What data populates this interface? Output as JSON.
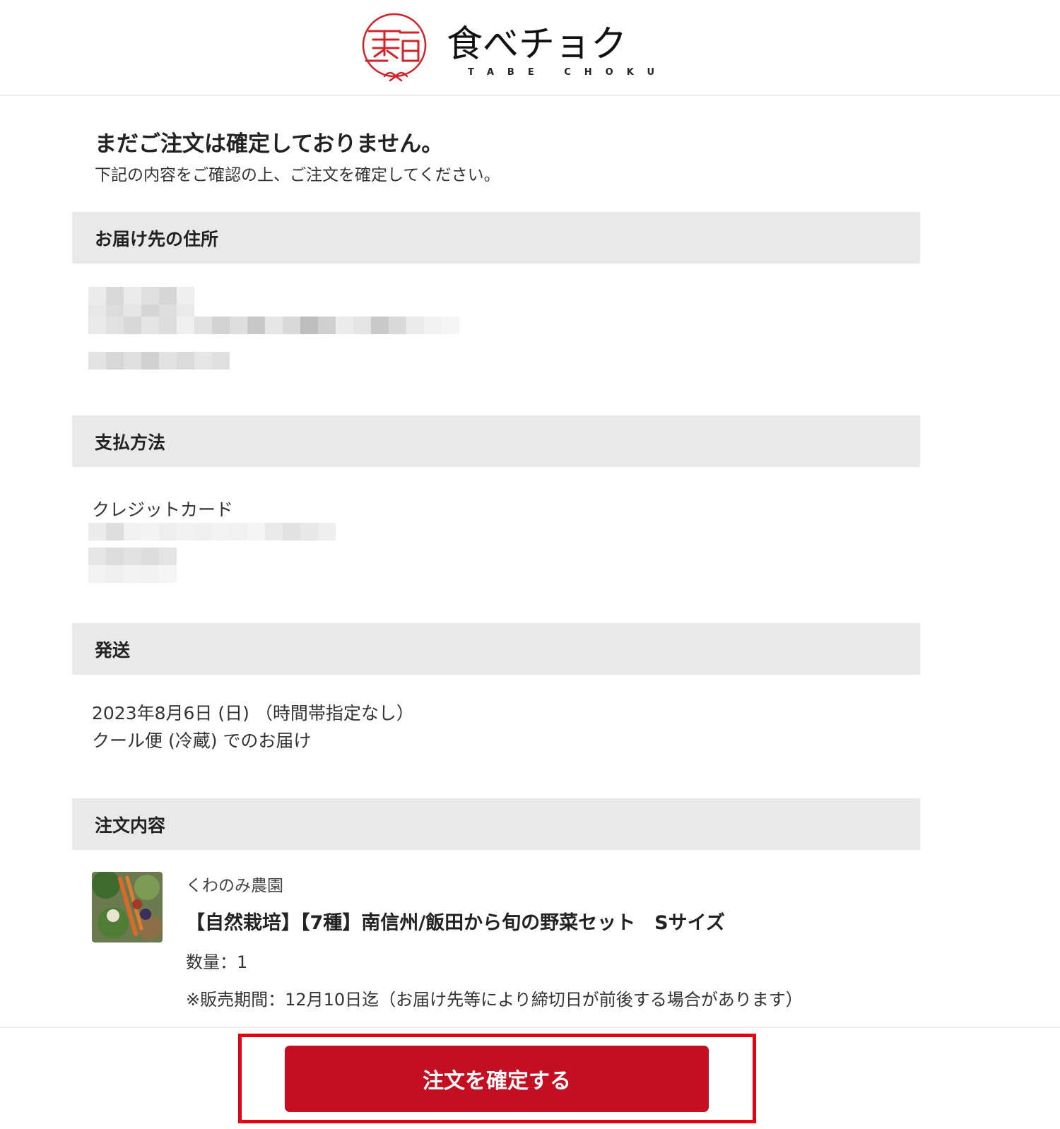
{
  "header": {
    "logo_main": "食べチョク",
    "logo_sub": "TABE CHOKU",
    "logo_mark_icon": "tabechoku-seal-icon",
    "brand_color": "#d2232a"
  },
  "intro": {
    "title": "まだご注文は確定しておりません。",
    "subtitle": "下記の内容をご確認の上、ご注文を確定してください。"
  },
  "sections": {
    "address": {
      "heading": "お届け先の住所"
    },
    "payment": {
      "heading": "支払方法",
      "method": "クレジットカード"
    },
    "shipping": {
      "heading": "発送",
      "date_line": "2023年8月6日 (日) （時間帯指定なし）",
      "method_line": "クール便 (冷蔵) でのお届け"
    },
    "order": {
      "heading": "注文内容",
      "items": [
        {
          "farm": "くわのみ農園",
          "title": "【自然栽培】【7種】南信州/飯田から旬の野菜セット　Sサイズ",
          "quantity": "数量：1",
          "sales_period": "※販売期間：12月10日迄（お届け先等により締切日が前後する場合があります）"
        }
      ]
    }
  },
  "confirm_button": {
    "label": "注文を確定する",
    "color": "#c40f22"
  },
  "highlight_color": "#e50012"
}
